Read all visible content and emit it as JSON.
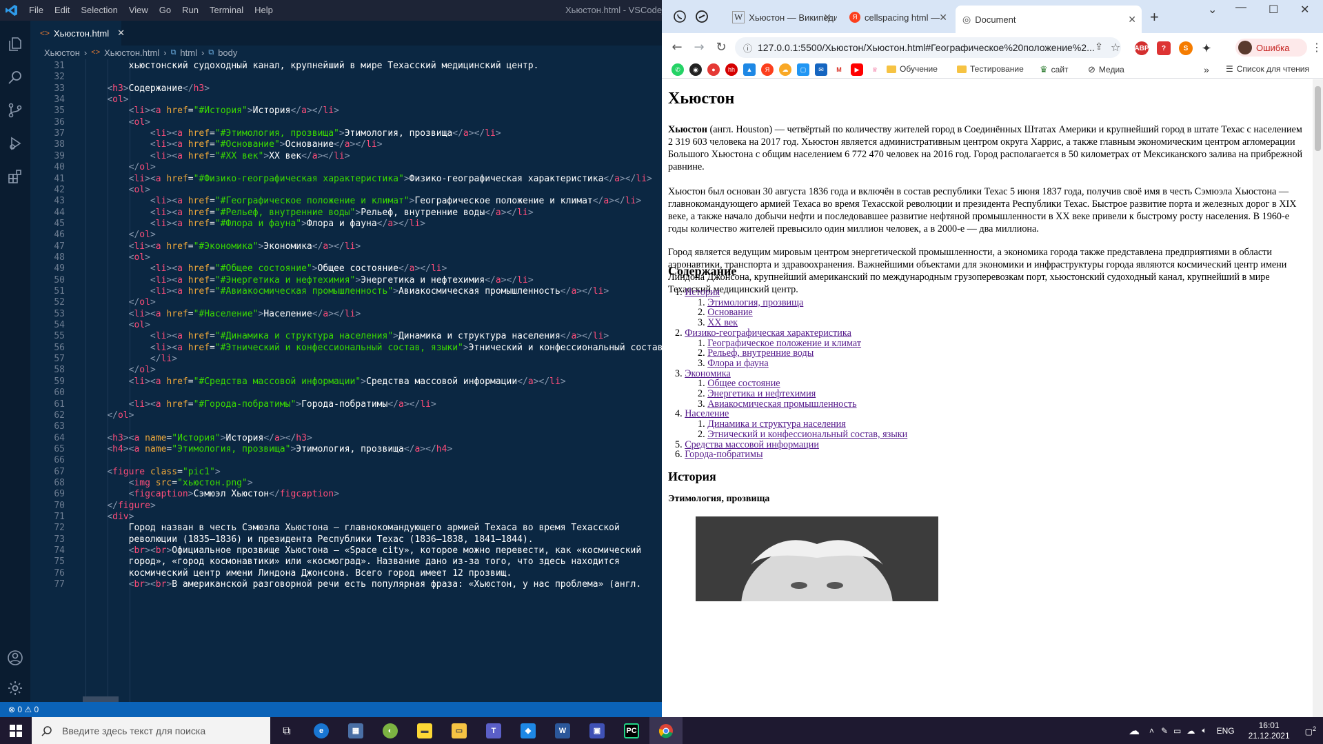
{
  "vscode": {
    "menu": [
      "File",
      "Edit",
      "Selection",
      "View",
      "Go",
      "Run",
      "Terminal",
      "Help"
    ],
    "window_title": "Хьюстон.html - VSCode_f",
    "tab_label": "Хьюстон.html",
    "breadcrumb": [
      "Хьюстон",
      "Хьюстон.html",
      "html",
      "body"
    ],
    "status": "⊗ 0 ⚠ 0",
    "code_lines": [
      {
        "n": "31",
        "t": "        хьюстонский судоходный канал, крупнейший в мире Техасский медицинский центр."
      },
      {
        "n": "32",
        "t": ""
      },
      {
        "n": "33",
        "t": "    <h3>Содержание</h3>"
      },
      {
        "n": "34",
        "t": "    <ol>"
      },
      {
        "n": "35",
        "t": "        <li><a href=\"#История\">История</a></li>"
      },
      {
        "n": "36",
        "t": "        <ol>"
      },
      {
        "n": "37",
        "t": "            <li><a href=\"#Этимология, прозвища\">Этимология, прозвища</a></li>"
      },
      {
        "n": "38",
        "t": "            <li><a href=\"#Основание\">Основание</a></li>"
      },
      {
        "n": "39",
        "t": "            <li><a href=\"#XX век\">XX век</a></li>"
      },
      {
        "n": "40",
        "t": "        </ol>"
      },
      {
        "n": "41",
        "t": "        <li><a href=\"#Физико-географическая характеристика\">Физико-географическая характеристика</a></li>"
      },
      {
        "n": "42",
        "t": "        <ol>"
      },
      {
        "n": "43",
        "t": "            <li><a href=\"#Географическое положение и климат\">Географическое положение и климат</a></li>"
      },
      {
        "n": "44",
        "t": "            <li><a href=\"#Рельеф, внутренние воды\">Рельеф, внутренние воды</a></li>"
      },
      {
        "n": "45",
        "t": "            <li><a href=\"#Флора и фауна\">Флора и фауна</a></li>"
      },
      {
        "n": "46",
        "t": "        </ol>"
      },
      {
        "n": "47",
        "t": "        <li><a href=\"#Экономика\">Экономика</a></li>"
      },
      {
        "n": "48",
        "t": "        <ol>"
      },
      {
        "n": "49",
        "t": "            <li><a href=\"#Общее состояние\">Общее состояние</a></li>"
      },
      {
        "n": "50",
        "t": "            <li><a href=\"#Энергетика и нефтехимия\">Энергетика и нефтехимия</a></li>"
      },
      {
        "n": "51",
        "t": "            <li><a href=\"#Авиакосмическая промышленность\">Авиакосмическая промышленность</a></li>"
      },
      {
        "n": "52",
        "t": "        </ol>"
      },
      {
        "n": "53",
        "t": "        <li><a href=\"#Население\">Население</a></li>"
      },
      {
        "n": "54",
        "t": "        <ol>"
      },
      {
        "n": "55",
        "t": "            <li><a href=\"#Динамика и структура населения\">Динамика и структура населения</a></li>"
      },
      {
        "n": "56",
        "t": "            <li><a href=\"#Этнический и конфессиональный состав, языки\">Этнический и конфессиональный состав, языки</a>"
      },
      {
        "n": "57",
        "t": "            </li>"
      },
      {
        "n": "58",
        "t": "        </ol>"
      },
      {
        "n": "59",
        "t": "        <li><a href=\"#Средства массовой информации\">Средства массовой информации</a></li>"
      },
      {
        "n": "60",
        "t": ""
      },
      {
        "n": "61",
        "t": "        <li><a href=\"#Города-побратимы\">Города-побратимы</a></li>"
      },
      {
        "n": "62",
        "t": "    </ol>"
      },
      {
        "n": "63",
        "t": ""
      },
      {
        "n": "64",
        "t": "    <h3><a name=\"История\">История</a></h3>"
      },
      {
        "n": "65",
        "t": "    <h4><a name=\"Этимология, прозвища\">Этимология, прозвища</a></h4>"
      },
      {
        "n": "66",
        "t": ""
      },
      {
        "n": "67",
        "t": "    <figure class=\"pic1\">"
      },
      {
        "n": "68",
        "t": "        <img src=\"хьюстон.png\">"
      },
      {
        "n": "69",
        "t": "        <figcaption>Сэмюэл Хьюстон</figcaption>"
      },
      {
        "n": "70",
        "t": "    </figure>"
      },
      {
        "n": "71",
        "t": "    <div>"
      },
      {
        "n": "72",
        "t": "        Город назван в честь Сэмюэла Хьюстона — главнокомандующего армией Техаса во время Техасской"
      },
      {
        "n": "73",
        "t": "        революции (1835—1836) и президента Республики Техас (1836—1838, 1841—1844)."
      },
      {
        "n": "74",
        "t": "        <br><br>Официальное прозвище Хьюстона — «Space city», которое можно перевести, как «космический"
      },
      {
        "n": "75",
        "t": "        город», «город космонавтики» или «космоград». Название дано из-за того, что здесь находится"
      },
      {
        "n": "76",
        "t": "        космический центр имени Линдона Джонсона. Всего город имеет 12 прозвищ."
      },
      {
        "n": "77",
        "t": "        <br><br>В американской разговорной речи есть популярная фраза: «Хьюстон, у нас проблема» (англ."
      }
    ]
  },
  "chrome": {
    "tabs": [
      "Хьюстон — Википедия",
      "cellspacing html — Яндекс",
      "Document"
    ],
    "url": "127.0.0.1:5500/Хьюстон/Хьюстон.html#Географическое%20положение%2...",
    "error_label": "Ошибка",
    "bookmarks": {
      "folders": [
        "Обучение",
        "Тестирование",
        "сайт",
        "Медиа"
      ],
      "reading_list": "Список для чтения"
    },
    "page": {
      "title": "Хьюстон",
      "p1_bold": "Хьюстон",
      "p1": " (англ. Houston) — четвёртый по количеству жителей город в Соединённых Штатах Америки и крупнейший город в штате Техас с населением 2 319 603 человека на 2017 год. Хьюстон является административным центром округа Харрис, а также главным экономическим центром агломерации Большого Хьюстона с общим населением 6 772 470 человек на 2016 год. Город располагается в 50 километрах от Мексиканского залива на прибрежной равнине.",
      "p2": "Хьюстон был основан 30 августа 1836 года и включён в состав республики Техас 5 июня 1837 года, получив своё имя в честь Сэмюэла Хьюстона — главнокомандующего армией Техаса во время Техасской революции и президента Республики Техас. Быстрое развитие порта и железных дорог в XIX веке, а также начало добычи нефти и последовавшее развитие нефтяной промышленности в XX веке привели к быстрому росту населения. В 1960-е годы количество жителей превысило один миллион человек, а в 2000-е — два миллиона.",
      "p3": "Город является ведущим мировым центром энергетической промышленности, а экономика города также представлена предприятиями в области аэронавтики, транспорта и здравоохранения. Важнейшими объектами для экономики и инфраструктуры города являются космический центр имени Линдона Джонсона, крупнейший американский по международным грузоперевозкам порт, хьюстонский судоходный канал, крупнейший в мире Техасский медицинский центр.",
      "toc_heading": "Содержание",
      "toc": [
        {
          "num": "1.",
          "label": "История",
          "level": 1
        },
        {
          "num": "1.",
          "label": "Этимология, прозвища",
          "level": 2
        },
        {
          "num": "2.",
          "label": "Основание",
          "level": 2
        },
        {
          "num": "3.",
          "label": "XX век",
          "level": 2
        },
        {
          "num": "2.",
          "label": "Физико-географическая характеристика",
          "level": 1
        },
        {
          "num": "1.",
          "label": "Географическое положение и климат",
          "level": 2
        },
        {
          "num": "2.",
          "label": "Рельеф, внутренние воды",
          "level": 2
        },
        {
          "num": "3.",
          "label": "Флора и фауна",
          "level": 2
        },
        {
          "num": "3.",
          "label": "Экономика",
          "level": 1
        },
        {
          "num": "1.",
          "label": "Общее состояние",
          "level": 2
        },
        {
          "num": "2.",
          "label": "Энергетика и нефтехимия",
          "level": 2
        },
        {
          "num": "3.",
          "label": "Авиакосмическая промышленность",
          "level": 2
        },
        {
          "num": "4.",
          "label": "Население",
          "level": 1
        },
        {
          "num": "1.",
          "label": "Динамика и структура населения",
          "level": 2
        },
        {
          "num": "2.",
          "label": "Этнический и конфессиональный состав, языки",
          "level": 2
        },
        {
          "num": "5.",
          "label": "Средства массовой информации",
          "level": 1
        },
        {
          "num": "6.",
          "label": "Города-побратимы",
          "level": 1
        }
      ],
      "history_heading": "История",
      "etym_heading": "Этимология, прозвища"
    }
  },
  "taskbar": {
    "search_placeholder": "Введите здесь текст для поиска",
    "lang": "ENG",
    "time": "16:01",
    "date": "21.12.2021",
    "notifications": "2"
  }
}
